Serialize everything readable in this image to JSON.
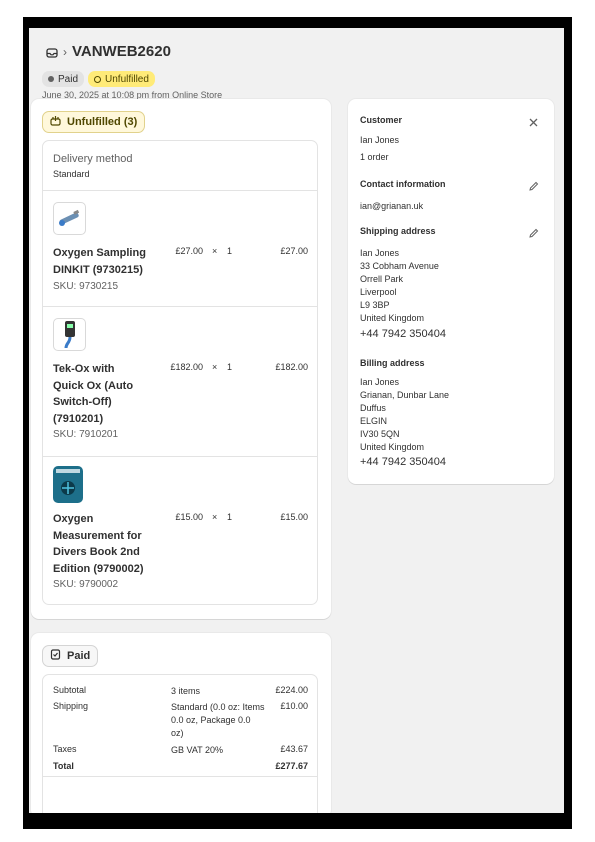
{
  "header": {
    "order_number": "VANWEB2620",
    "separator": "›",
    "badges": {
      "paid": "Paid",
      "unfulfilled": "Unfulfilled"
    },
    "meta": "June 30, 2025 at 10:08 pm from Online Store"
  },
  "fulfillment": {
    "status_label": "Unfulfilled (3)",
    "delivery_method_label": "Delivery method",
    "delivery_method_value": "Standard",
    "items": [
      {
        "name_lines": [
          "Oxygen Sampling",
          "DINKIT (9730215)"
        ],
        "sku": "SKU: 9730215",
        "price": "£27.00",
        "times": "×",
        "qty": "1",
        "total": "£27.00",
        "thumb_icon": "sampling-kit-image"
      },
      {
        "name_lines": [
          "Tek-Ox with",
          "Quick Ox (Auto",
          "Switch-Off)",
          "(7910201)"
        ],
        "sku": "SKU: 7910201",
        "price": "£182.00",
        "times": "×",
        "qty": "1",
        "total": "£182.00",
        "thumb_icon": "oxygen-analyser-image"
      },
      {
        "name_lines": [
          "Oxygen",
          "Measurement for",
          "Divers Book 2nd",
          "Edition (9790002)"
        ],
        "sku": "SKU: 9790002",
        "price": "£15.00",
        "times": "×",
        "qty": "1",
        "total": "£15.00",
        "thumb_icon": "book-cover-image"
      }
    ]
  },
  "customer": {
    "heading": "Customer",
    "name": "Ian Jones",
    "orders": "1 order",
    "contact_heading": "Contact information",
    "email": "ian@grianan.uk",
    "shipping_heading": "Shipping address",
    "shipping_lines": [
      "Ian Jones",
      "33 Cobham Avenue",
      "Orrell Park",
      "Liverpool",
      "L9 3BP",
      "United Kingdom"
    ],
    "shipping_phone": "+44 7942 350404",
    "billing_heading": "Billing address",
    "billing_lines": [
      "Ian Jones",
      "Grianan, Dunbar Lane",
      "Duffus",
      "ELGIN",
      "IV30 5QN",
      "United Kingdom"
    ],
    "billing_phone": "+44 7942 350404"
  },
  "payment": {
    "status_label": "Paid",
    "rows": [
      {
        "label": "Subtotal",
        "desc_lines": [
          "3 items"
        ],
        "amount": "£224.00"
      },
      {
        "label": "Shipping",
        "desc_lines": [
          "Standard (0.0 oz: Items",
          "0.0 oz, Package 0.0",
          "oz)"
        ],
        "amount": "£10.00"
      },
      {
        "label": "Taxes",
        "desc_lines": [
          "GB VAT 20%"
        ],
        "amount": "£43.67"
      },
      {
        "label": "Total",
        "desc_lines": [],
        "amount": "£277.67"
      }
    ]
  },
  "colors": {
    "unfulfilled_badge": "#ffeb78",
    "paid_badge": "#e3e3e3",
    "background": "#f1f1f1"
  }
}
